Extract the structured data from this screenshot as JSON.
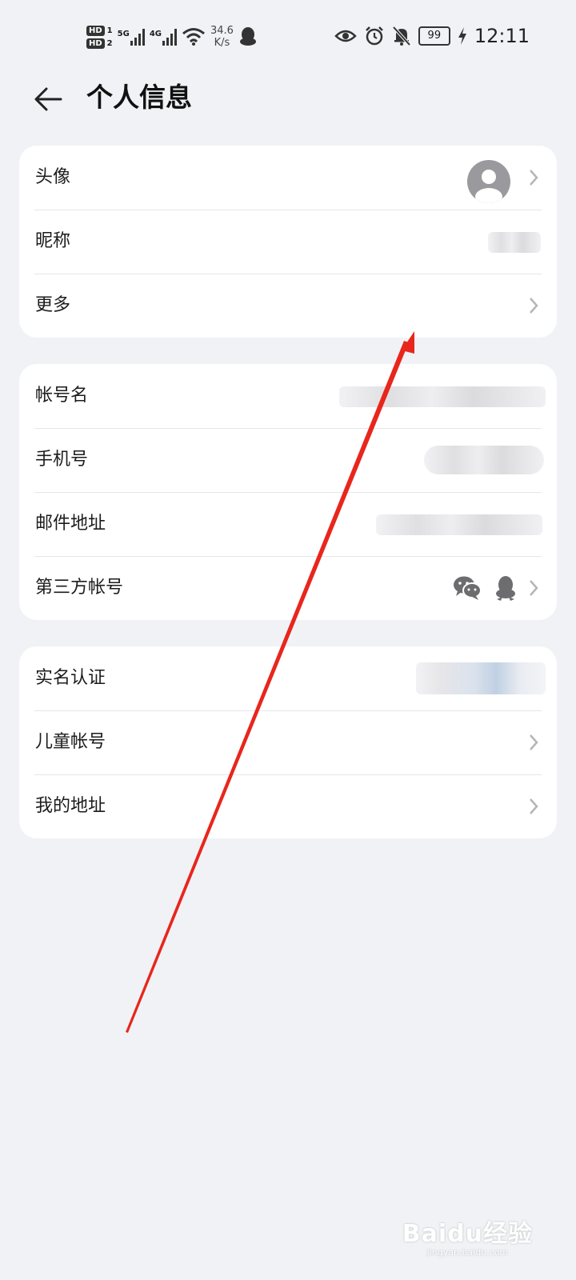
{
  "status_bar": {
    "hd1": "HD",
    "hd1_num": "1",
    "hd2": "HD",
    "hd2_num": "2",
    "net1": "5G",
    "net2": "4G",
    "speed_value": "34.6",
    "speed_unit": "K/s",
    "battery": "99",
    "time": "12:11",
    "icons": [
      "signal-icon",
      "wifi-icon",
      "qq-icon",
      "eye-icon",
      "alarm-icon",
      "bell-mute-icon",
      "battery-icon",
      "charging-icon"
    ]
  },
  "header": {
    "title": "个人信息"
  },
  "group1": [
    {
      "label": "头像"
    },
    {
      "label": "昵称"
    },
    {
      "label": "更多"
    }
  ],
  "group2": [
    {
      "label": "帐号名"
    },
    {
      "label": "手机号"
    },
    {
      "label": "邮件地址"
    },
    {
      "label": "第三方帐号"
    }
  ],
  "group3": [
    {
      "label": "实名认证"
    },
    {
      "label": "儿童帐号"
    },
    {
      "label": "我的地址"
    }
  ],
  "watermark": {
    "brand": "Baidu经验",
    "url": "jingyan.baidu.com"
  },
  "colors": {
    "background": "#f1f2f6",
    "card": "#ffffff",
    "annotation_arrow": "#e8261c"
  }
}
